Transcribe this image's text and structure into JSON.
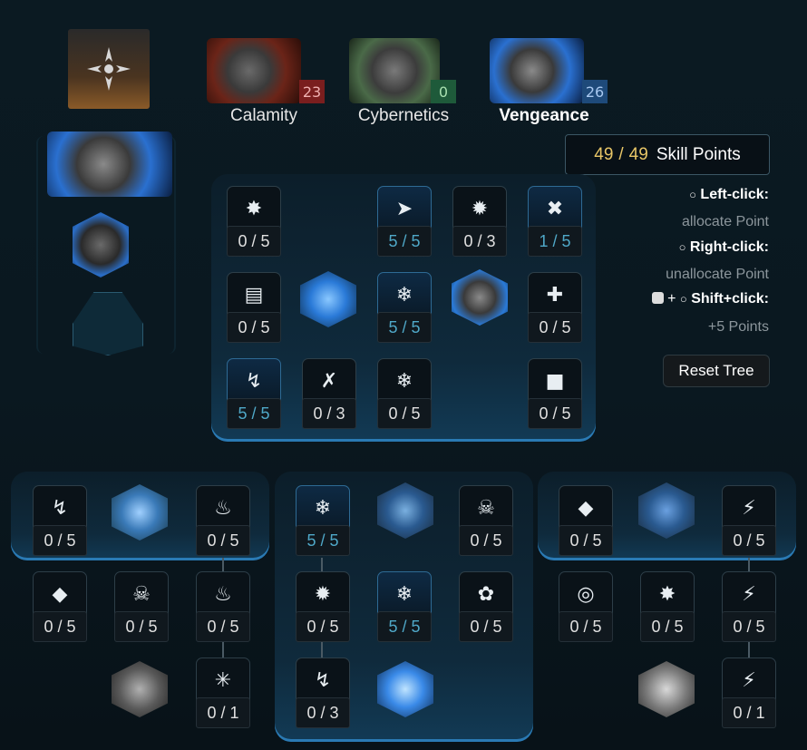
{
  "specs": [
    {
      "name": "Calamity",
      "points": "23",
      "badge_color": "#7a1e1e"
    },
    {
      "name": "Cybernetics",
      "points": "0",
      "badge_color": "#1e5a3a"
    },
    {
      "name": "Vengeance",
      "points": "26",
      "badge_color": "#1e4a7a"
    }
  ],
  "skill_points": {
    "current": "49",
    "separator": "/",
    "max": "49",
    "label": "Skill Points"
  },
  "help": {
    "left_key": "Left-click:",
    "left_desc": "allocate Point",
    "right_key": "Right-click:",
    "right_desc": "unallocate Point",
    "shift_plus": "+",
    "shift_key": "Shift+click:",
    "shift_desc": "+5 Points"
  },
  "reset_label": "Reset Tree",
  "main_tree": [
    {
      "count": "0 / 5",
      "on": false,
      "icon": "gear-target-icon"
    },
    {
      "count": "5 / 5",
      "on": true,
      "icon": "missiles-icon"
    },
    {
      "count": "0 / 3",
      "on": false,
      "icon": "spiked-orb-icon"
    },
    {
      "count": "1 / 5",
      "on": true,
      "icon": "crossed-blades-icon"
    },
    {
      "count": "0 / 5",
      "on": false,
      "icon": "turret-icon"
    },
    {
      "count": "5 / 5",
      "on": true,
      "icon": "frost-shield-icon"
    },
    {
      "count": "0 / 5",
      "on": false,
      "icon": "medkit-icon"
    },
    {
      "count": "5 / 5",
      "on": true,
      "icon": "lightning-bolt-icon"
    },
    {
      "count": "0 / 3",
      "on": false,
      "icon": "crossed-tools-icon"
    },
    {
      "count": "0 / 5",
      "on": false,
      "icon": "snowflake-icon"
    },
    {
      "count": "0 / 5",
      "on": false,
      "icon": "robot-icon"
    }
  ],
  "left_tree": [
    {
      "count": "0 / 5",
      "on": false,
      "icon": "swirl-icon"
    },
    {
      "count": "0 / 5",
      "on": false,
      "icon": "flame-icon"
    },
    {
      "count": "0 / 5",
      "on": false,
      "icon": "shield-icon"
    },
    {
      "count": "0 / 5",
      "on": false,
      "icon": "skull-flame-icon"
    },
    {
      "count": "0 / 5",
      "on": false,
      "icon": "fire-icon"
    },
    {
      "count": "0 / 1",
      "on": false,
      "icon": "burst-icon"
    }
  ],
  "mid_tree": [
    {
      "count": "5 / 5",
      "on": true,
      "icon": "snowflake-cross-icon"
    },
    {
      "count": "0 / 5",
      "on": false,
      "icon": "skull-frost-icon"
    },
    {
      "count": "0 / 5",
      "on": false,
      "icon": "spiked-gear-icon"
    },
    {
      "count": "5 / 5",
      "on": true,
      "icon": "frost-shield-icon"
    },
    {
      "count": "0 / 5",
      "on": false,
      "icon": "cluster-icon"
    },
    {
      "count": "0 / 3",
      "on": false,
      "icon": "frost-swirl-icon"
    }
  ],
  "right_tree": [
    {
      "count": "0 / 5",
      "on": false,
      "icon": "drone-icon"
    },
    {
      "count": "0 / 5",
      "on": false,
      "icon": "lightning-icon"
    },
    {
      "count": "0 / 5",
      "on": false,
      "icon": "target-icon"
    },
    {
      "count": "0 / 5",
      "on": false,
      "icon": "star-burst-icon"
    },
    {
      "count": "0 / 5",
      "on": false,
      "icon": "lightning-strike-icon"
    },
    {
      "count": "0 / 1",
      "on": false,
      "icon": "lightning-cross-icon"
    }
  ]
}
